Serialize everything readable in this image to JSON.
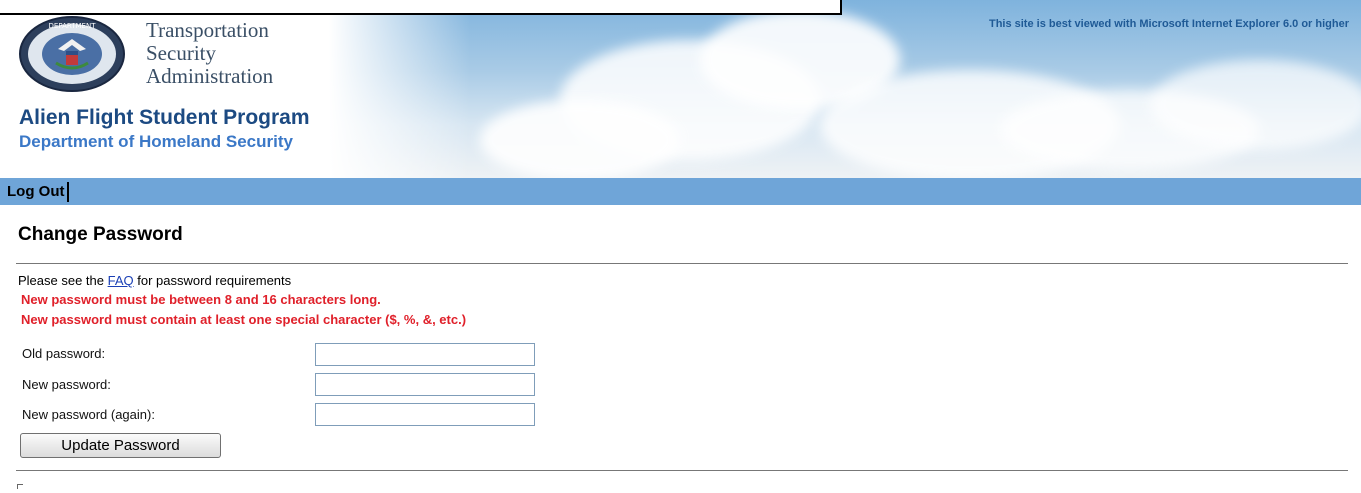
{
  "header": {
    "agency_lines": [
      "Transportation",
      "Security",
      "Administration"
    ],
    "program_title": "Alien Flight Student Program",
    "department": "Department of Homeland Security",
    "browser_note": "This site is best viewed with Microsoft Internet Explorer 6.0 or higher",
    "seal_icon": "dhs-seal-icon"
  },
  "nav": {
    "logout_label": "Log Out",
    "bar_color": "#6fa5d8"
  },
  "page": {
    "title": "Change Password"
  },
  "form": {
    "info_prefix": "Please see the ",
    "faq_link": "FAQ",
    "info_suffix": " for password requirements",
    "requirements": [
      "New password must be between 8 and 16 characters long.",
      "New password must contain at least one special character ($, %, &, etc.)"
    ],
    "fields": [
      {
        "label": "Old password:",
        "value": ""
      },
      {
        "label": "New password:",
        "value": ""
      },
      {
        "label": "New password (again):",
        "value": ""
      }
    ],
    "submit_label": "Update Password",
    "error_color": "#e0202a"
  }
}
